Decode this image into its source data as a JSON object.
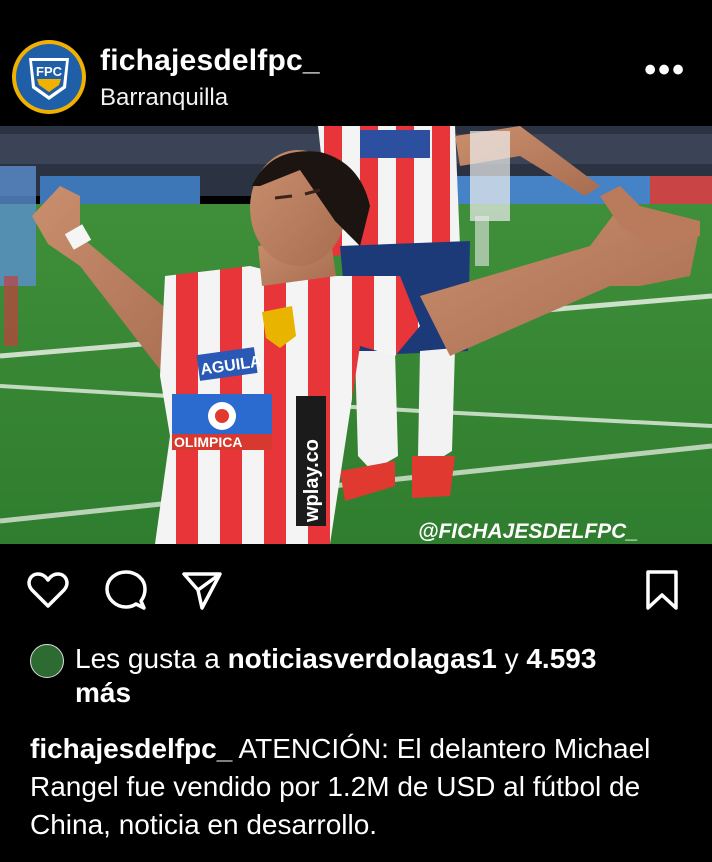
{
  "post": {
    "username": "fichajesdelfpc_",
    "location": "Barranquilla",
    "more_label": "•••"
  },
  "avatar": {
    "logo_text": "FPC"
  },
  "photo": {
    "watermark": "@FICHAJESDELFPC_",
    "sponsor_1": "AGUILA",
    "sponsor_2": "OLIMPICA",
    "sponsor_3": "wplay.co"
  },
  "likes": {
    "prefix": "Les gusta a ",
    "user": "noticiasverdolagas1",
    "middle": " y ",
    "count": "4.593",
    "suffix": "más"
  },
  "caption": {
    "username": "fichajesdelfpc_",
    "text": "ATENCIÓN: El delantero Michael Rangel fue vendido por 1.2M de USD al fútbol de China, noticia en desarrollo."
  },
  "colors": {
    "background": "#000000",
    "text": "#ffffff",
    "avatar_ring": "#f1b100",
    "avatar_bg": "#1f5fa8"
  },
  "icons": {
    "like": "heart-icon",
    "comment": "comment-icon",
    "share": "send-icon",
    "save": "bookmark-icon",
    "more": "more-icon"
  }
}
